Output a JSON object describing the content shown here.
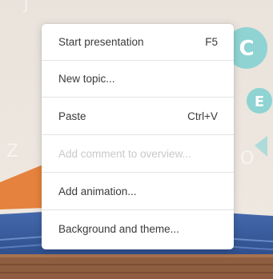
{
  "background": {
    "bubble_glyph_1": "C",
    "bubble_glyph_2": "E",
    "colors": {
      "wall": "#ece5dc",
      "bubble": "#8fd3d3",
      "book_orange": "#e5823d",
      "book_blue": "#3d62a6",
      "table": "#8f5e40"
    }
  },
  "menu": {
    "items": [
      {
        "label": "Start presentation",
        "shortcut": "F5"
      },
      {
        "label": "New topic..."
      },
      {
        "label": "Paste",
        "shortcut": "Ctrl+V"
      },
      {
        "label": "Add comment to overview...",
        "disabled": true
      },
      {
        "label": "Add animation..."
      },
      {
        "label": "Background and theme..."
      }
    ]
  }
}
